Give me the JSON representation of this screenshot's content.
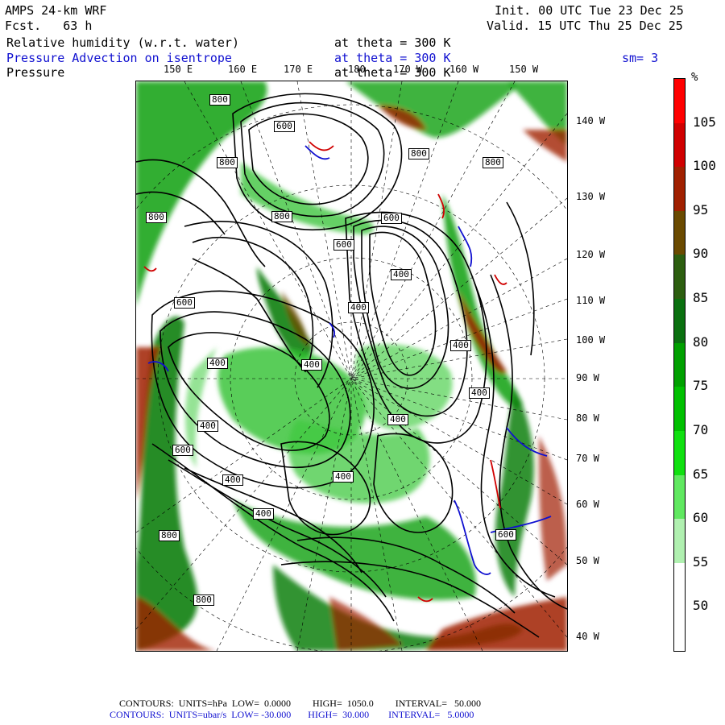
{
  "header": {
    "model": "AMPS 24-km WRF",
    "fcst_label": "Fcst.",
    "fcst_value": "63 h",
    "init": "Init. 00 UTC Tue 23 Dec 25",
    "valid": "Valid. 15 UTC Thu 25 Dec 25"
  },
  "fields": [
    {
      "name": "Relative humidity (w.r.t. water)",
      "level": "at theta = 300 K",
      "color": "#000000"
    },
    {
      "name": "Pressure Advection on isentrope",
      "level": "at theta = 300 K",
      "extra": "sm= 3",
      "color": "#1010d0"
    },
    {
      "name": "Pressure",
      "level": "at theta = 300 K",
      "color": "#000000"
    }
  ],
  "longitude_top": [
    "150 E",
    "160 E",
    "170 E",
    "180",
    "170 W",
    "160 W",
    "150 W"
  ],
  "longitude_right": [
    "140 W",
    "130 W",
    "120 W",
    "110 W",
    "100 W",
    "90 W",
    "80 W",
    "70 W",
    "60 W",
    "50 W",
    "40 W"
  ],
  "isobar_labels": [
    "800",
    "600",
    "800",
    "800",
    "600",
    "800",
    "800",
    "600",
    "800",
    "400",
    "400",
    "600",
    "400",
    "400",
    "400",
    "400",
    "400",
    "400",
    "400",
    "400",
    "600",
    "400",
    "600",
    "800",
    "800"
  ],
  "colorbar": {
    "unit": "%",
    "ticks": [
      "105",
      "100",
      "95",
      "90",
      "85",
      "80",
      "75",
      "70",
      "65",
      "60",
      "55",
      "50"
    ],
    "colors": [
      "#ff0000",
      "#d00000",
      "#a02000",
      "#6a4a00",
      "#2c5e10",
      "#0a7010",
      "#00a000",
      "#00c000",
      "#10e010",
      "#60e860",
      "#b0f0b0",
      "#ffffff",
      "#ffffff"
    ]
  },
  "footer": {
    "line1": "CONTOURS:  UNITS=hPa  LOW=  0.0000         HIGH=  1050.0         INTERVAL=   50.000",
    "line2": "CONTOURS:  UNITS=ubar/s  LOW= -30.000       HIGH=  30.000        INTERVAL=   5.0000"
  }
}
